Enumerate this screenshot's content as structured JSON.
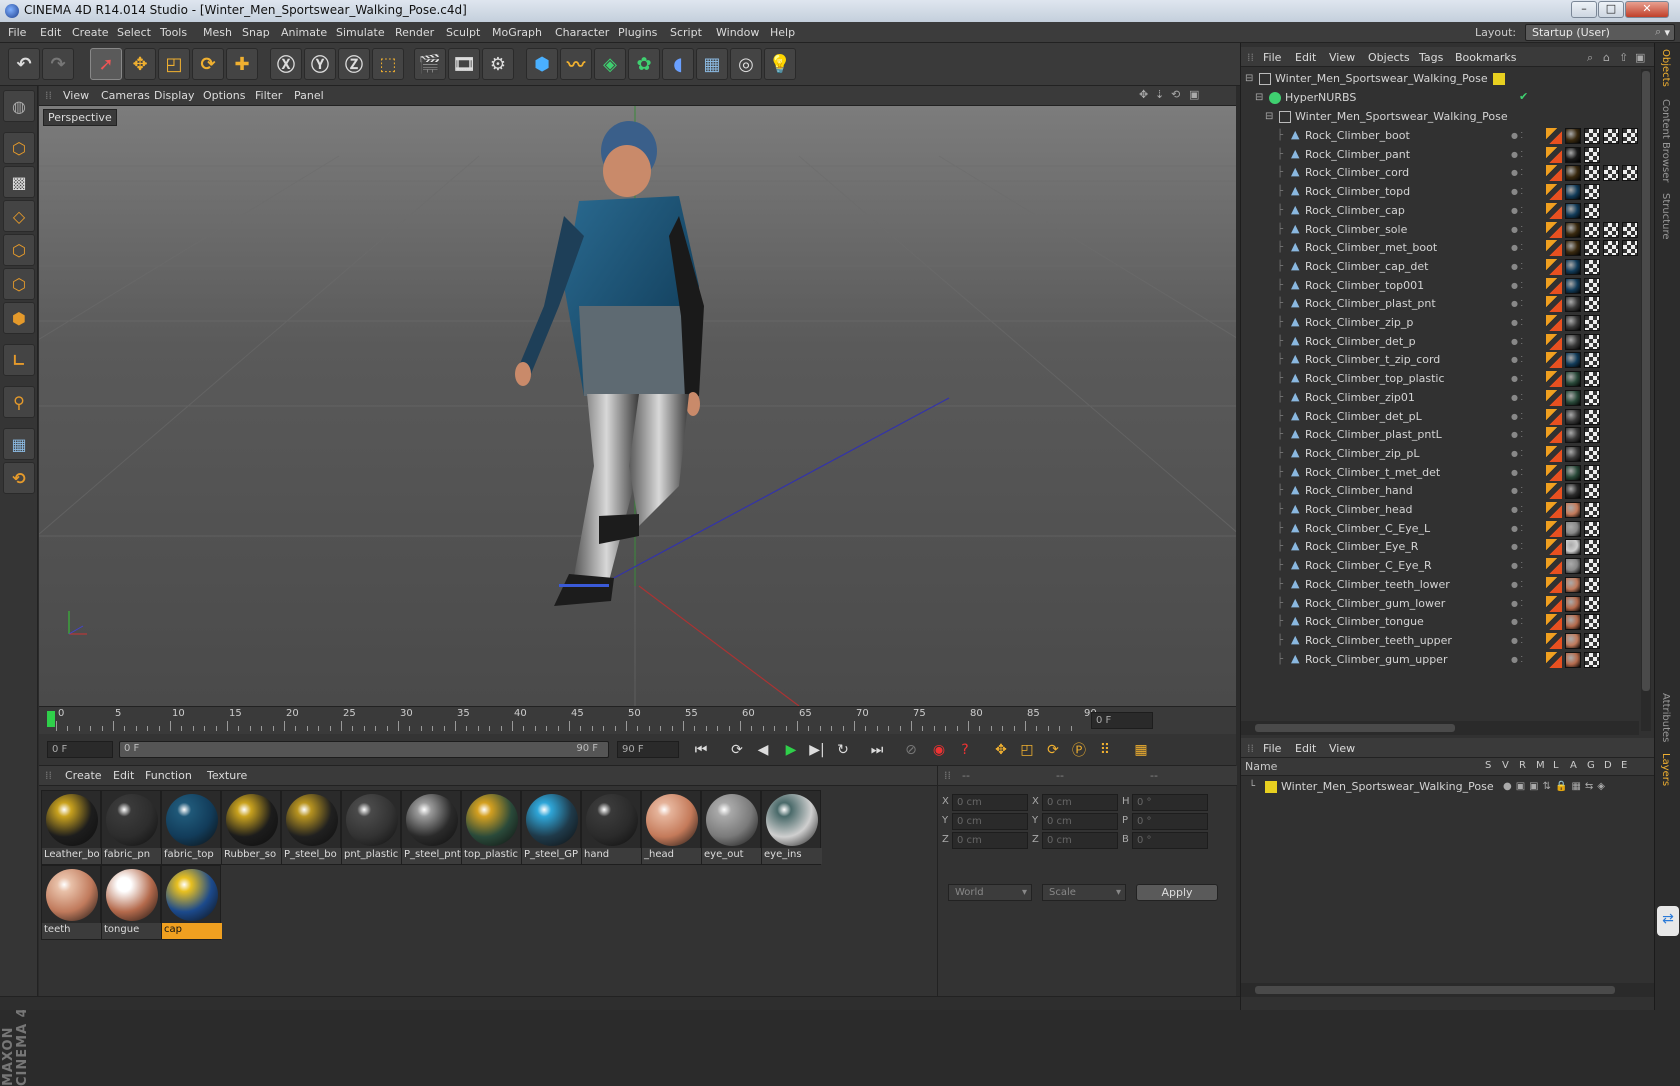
{
  "window": {
    "title": "CINEMA 4D R14.014 Studio - [Winter_Men_Sportswear_Walking_Pose.c4d]",
    "minimize": "–",
    "maximize": "□",
    "close": "✕"
  },
  "menu": [
    "File",
    "Edit",
    "Create",
    "Select",
    "Tools",
    "Mesh",
    "Snap",
    "Animate",
    "Simulate",
    "Render",
    "Sculpt",
    "MoGraph",
    "Character",
    "Plugins",
    "Script",
    "Window",
    "Help"
  ],
  "layout": {
    "label": "Layout:",
    "value": "Startup (User)"
  },
  "viewport": {
    "menu": [
      "View",
      "Cameras",
      "Display",
      "Options",
      "Filter",
      "Panel"
    ],
    "label": "Perspective"
  },
  "timeline": {
    "ticks": [
      "0",
      "5",
      "10",
      "15",
      "20",
      "25",
      "30",
      "35",
      "40",
      "45",
      "50",
      "55",
      "60",
      "65",
      "70",
      "75",
      "80",
      "85",
      "90"
    ],
    "current_frame": "0 F"
  },
  "transport": {
    "start": "0 F",
    "range_start": "0 F",
    "range_end": "90 F",
    "end": "90 F"
  },
  "materials": {
    "menu": [
      "Create",
      "Edit",
      "Function",
      "Texture"
    ],
    "items": [
      {
        "label": "Leather_bo",
        "color": "#1d1d1d",
        "accent": "#c9a21e"
      },
      {
        "label": "fabric_pn",
        "color": "#2d2d2d",
        "accent": "#3a3a3a"
      },
      {
        "label": "fabric_top",
        "color": "#123c5a",
        "accent": "#1f5878"
      },
      {
        "label": "Rubber_so",
        "color": "#1c1c1c",
        "accent": "#c9a21e"
      },
      {
        "label": "P_steel_bo",
        "color": "#202020",
        "accent": "#b89420"
      },
      {
        "label": "pnt_plastic",
        "color": "#333333",
        "accent": "#4a4a4a"
      },
      {
        "label": "P_steel_pnt",
        "color": "#2a2a2a",
        "accent": "#9a9a9a"
      },
      {
        "label": "top_plastic",
        "color": "#2a4a3a",
        "accent": "#d4a020"
      },
      {
        "label": "P_steel_GP",
        "color": "#1f3a4a",
        "accent": "#2fa6d8"
      },
      {
        "label": "hand",
        "color": "#2b2b2b",
        "accent": "#3a3a3a"
      },
      {
        "label": "_head",
        "color": "#c47a5a",
        "accent": "#e5b39a"
      },
      {
        "label": "eye_out",
        "color": "#7a7a7a",
        "accent": "#a8a8a8"
      },
      {
        "label": "eye_ins",
        "color": "#cfcfcf",
        "accent": "#4a6a6a"
      },
      {
        "label": "teeth",
        "color": "#c07a5c",
        "accent": "#e8c0a8"
      },
      {
        "label": "tongue",
        "color": "#b46a4c",
        "accent": "#ffffff"
      },
      {
        "label": "cap",
        "color": "#1c4a8c",
        "accent": "#e8c020"
      }
    ]
  },
  "coords": {
    "headers": [
      "--",
      "--",
      "--"
    ],
    "rows": [
      {
        "a": "X",
        "av": "0 cm",
        "b": "X",
        "bv": "0 cm",
        "c": "H",
        "cv": "0 °"
      },
      {
        "a": "Y",
        "av": "0 cm",
        "b": "Y",
        "bv": "0 cm",
        "c": "P",
        "cv": "0 °"
      },
      {
        "a": "Z",
        "av": "0 cm",
        "b": "Z",
        "bv": "0 cm",
        "c": "B",
        "cv": "0 °"
      }
    ],
    "world": "World",
    "scale": "Scale",
    "apply": "Apply"
  },
  "objects": {
    "menu": [
      "File",
      "Edit",
      "View",
      "Objects",
      "Tags",
      "Bookmarks"
    ],
    "root": "Winter_Men_Sportswear_Walking_Pose",
    "hypernurbs": "HyperNURBS",
    "group": "Winter_Men_Sportswear_Walking_Pose",
    "items": [
      {
        "name": "Rock_Climber_boot",
        "tag": "#3a2a10",
        "extra": 3
      },
      {
        "name": "Rock_Climber_pant",
        "tag": "#1a1a1a",
        "extra": 1
      },
      {
        "name": "Rock_Climber_cord",
        "tag": "#3a2a10",
        "extra": 3
      },
      {
        "name": "Rock_Climber_topd",
        "tag": "#123c5a",
        "extra": 1
      },
      {
        "name": "Rock_Climber_cap",
        "tag": "#123c5a",
        "extra": 1
      },
      {
        "name": "Rock_Climber_sole",
        "tag": "#3a2a10",
        "extra": 3
      },
      {
        "name": "Rock_Climber_met_boot",
        "tag": "#3a2a10",
        "extra": 3
      },
      {
        "name": "Rock_Climber_cap_det",
        "tag": "#123c5a",
        "extra": 1
      },
      {
        "name": "Rock_Climber_top001",
        "tag": "#123c5a",
        "extra": 1
      },
      {
        "name": "Rock_Climber_plast_pnt",
        "tag": "#3a3a3a",
        "extra": 1
      },
      {
        "name": "Rock_Climber_zip_p",
        "tag": "#3a3a3a",
        "extra": 1
      },
      {
        "name": "Rock_Climber_det_p",
        "tag": "#3a3a3a",
        "extra": 1
      },
      {
        "name": "Rock_Climber_t_zip_cord",
        "tag": "#123c5a",
        "extra": 1
      },
      {
        "name": "Rock_Climber_top_plastic",
        "tag": "#2a4a3a",
        "extra": 1
      },
      {
        "name": "Rock_Climber_zip01",
        "tag": "#2a4a3a",
        "extra": 1
      },
      {
        "name": "Rock_Climber_det_pL",
        "tag": "#3a3a3a",
        "extra": 1
      },
      {
        "name": "Rock_Climber_plast_pntL",
        "tag": "#3a3a3a",
        "extra": 1
      },
      {
        "name": "Rock_Climber_zip_pL",
        "tag": "#3a3a3a",
        "extra": 1
      },
      {
        "name": "Rock_Climber_t_met_det",
        "tag": "#2a4a3a",
        "extra": 1
      },
      {
        "name": "Rock_Climber_hand",
        "tag": "#2b2b2b",
        "extra": 1
      },
      {
        "name": "Rock_Climber_head",
        "tag": "#c47a5a",
        "extra": 1
      },
      {
        "name": "Rock_Climber_C_Eye_L",
        "tag": "#888888",
        "extra": 1
      },
      {
        "name": "Rock_Climber_Eye_R",
        "tag": "#cfcfcf",
        "extra": 1
      },
      {
        "name": "Rock_Climber_C_Eye_R",
        "tag": "#888888",
        "extra": 1
      },
      {
        "name": "Rock_Climber_teeth_lower",
        "tag": "#c07a5c",
        "extra": 1
      },
      {
        "name": "Rock_Climber_gum_lower",
        "tag": "#b46a4c",
        "extra": 1
      },
      {
        "name": "Rock_Climber_tongue",
        "tag": "#b46a4c",
        "extra": 1
      },
      {
        "name": "Rock_Climber_teeth_upper",
        "tag": "#c07a5c",
        "extra": 1
      },
      {
        "name": "Rock_Climber_gum_upper",
        "tag": "#b46a4c",
        "extra": 1
      }
    ]
  },
  "layers": {
    "menu": [
      "File",
      "Edit",
      "View"
    ],
    "name_header": "Name",
    "columns": [
      "S",
      "V",
      "R",
      "M",
      "L",
      "A",
      "G",
      "D",
      "E"
    ],
    "row": "Winter_Men_Sportswear_Walking_Pose"
  },
  "side_tabs": [
    "Objects",
    "Content Browser",
    "Structure",
    "Attributes",
    "Layers"
  ]
}
